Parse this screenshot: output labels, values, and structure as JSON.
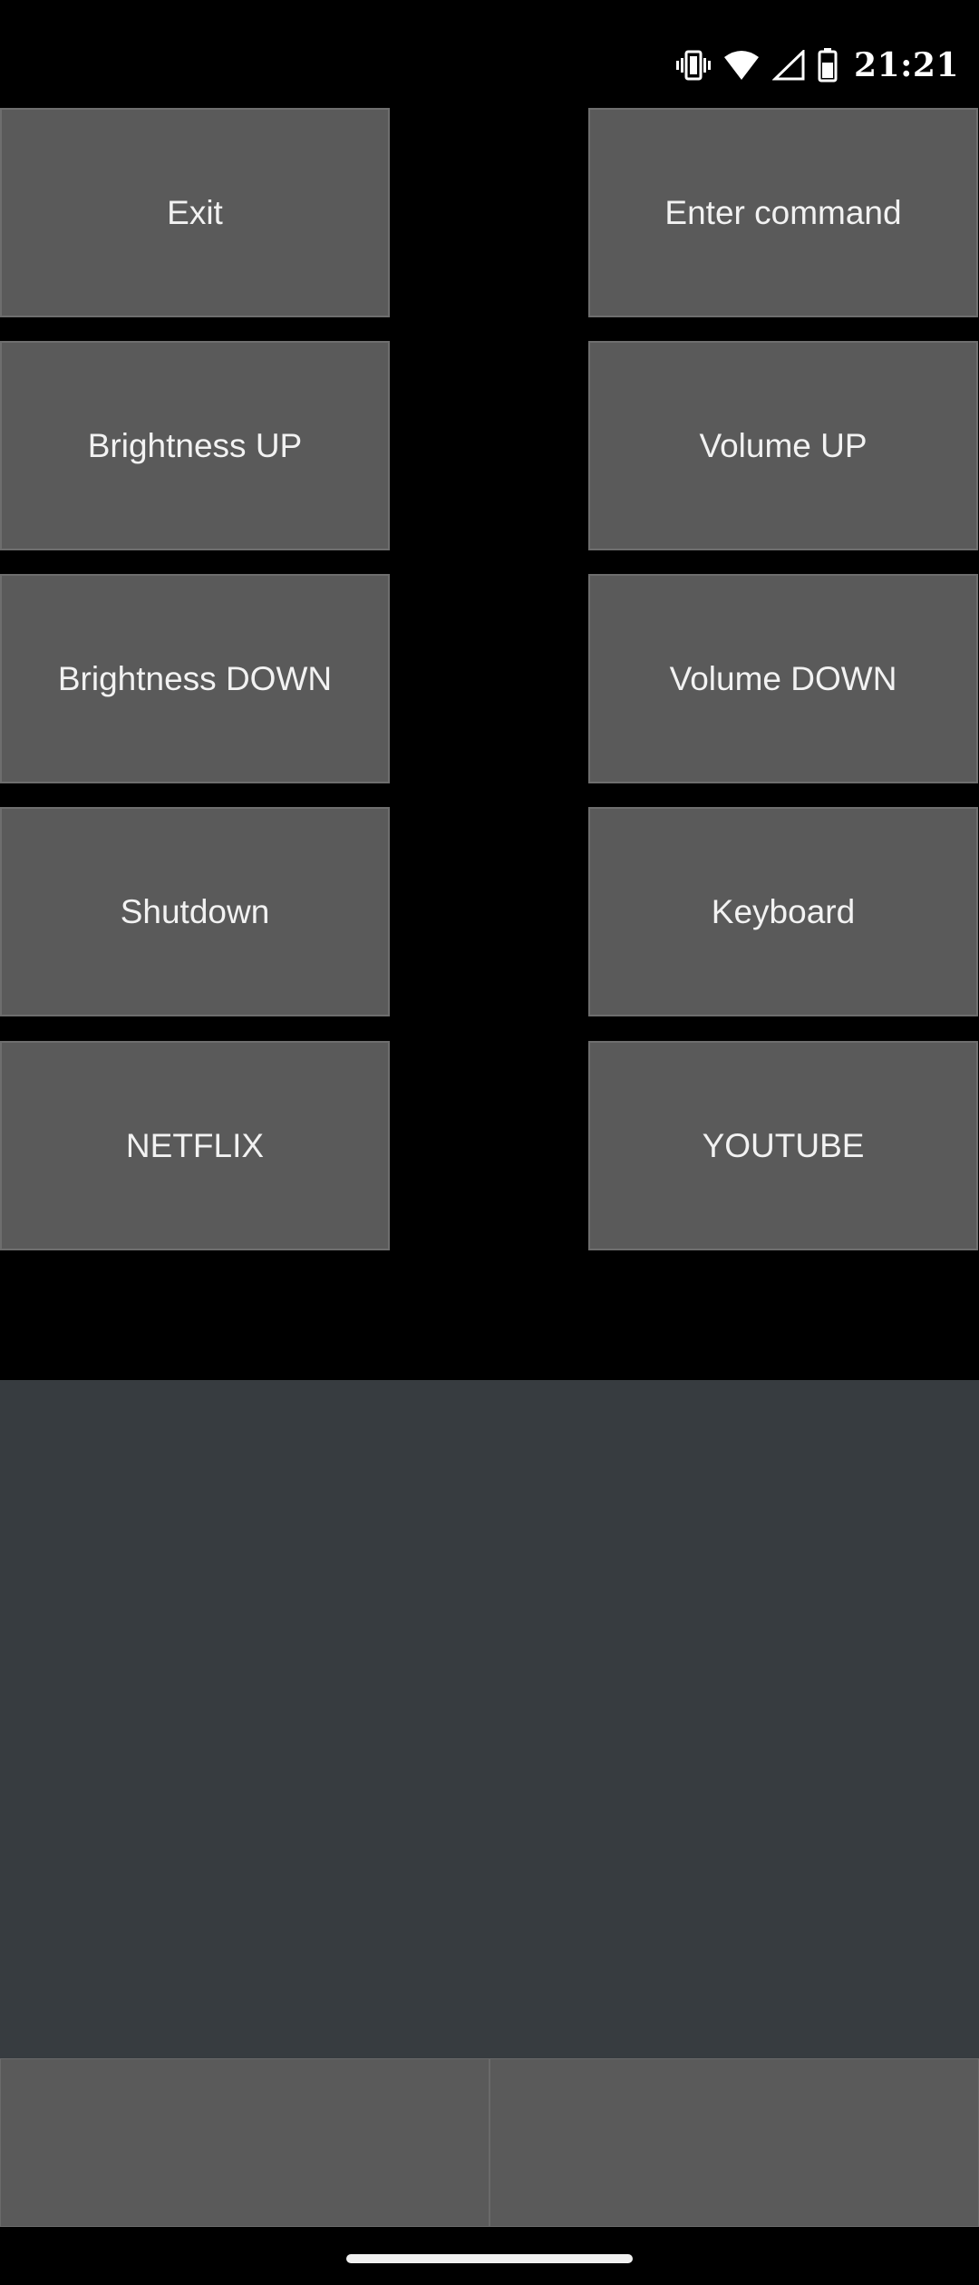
{
  "status_bar": {
    "time": "21:21",
    "icons": [
      "vibrate-icon",
      "wifi-icon",
      "cell-signal-icon",
      "battery-icon"
    ]
  },
  "buttons": {
    "exit": "Exit",
    "enter_command": "Enter command",
    "brightness_up": "Brightness UP",
    "volume_up": "Volume UP",
    "brightness_down": "Brightness DOWN",
    "volume_down": "Volume DOWN",
    "shutdown": "Shutdown",
    "keyboard": "Keyboard",
    "netflix": "NETFLIX",
    "youtube": "YOUTUBE"
  },
  "touchpad": {
    "left_click_label": "",
    "right_click_label": ""
  },
  "colors": {
    "background": "#000000",
    "button": "#5a5a5a",
    "touchpad": "#373c40",
    "text": "#f2f2f2"
  }
}
